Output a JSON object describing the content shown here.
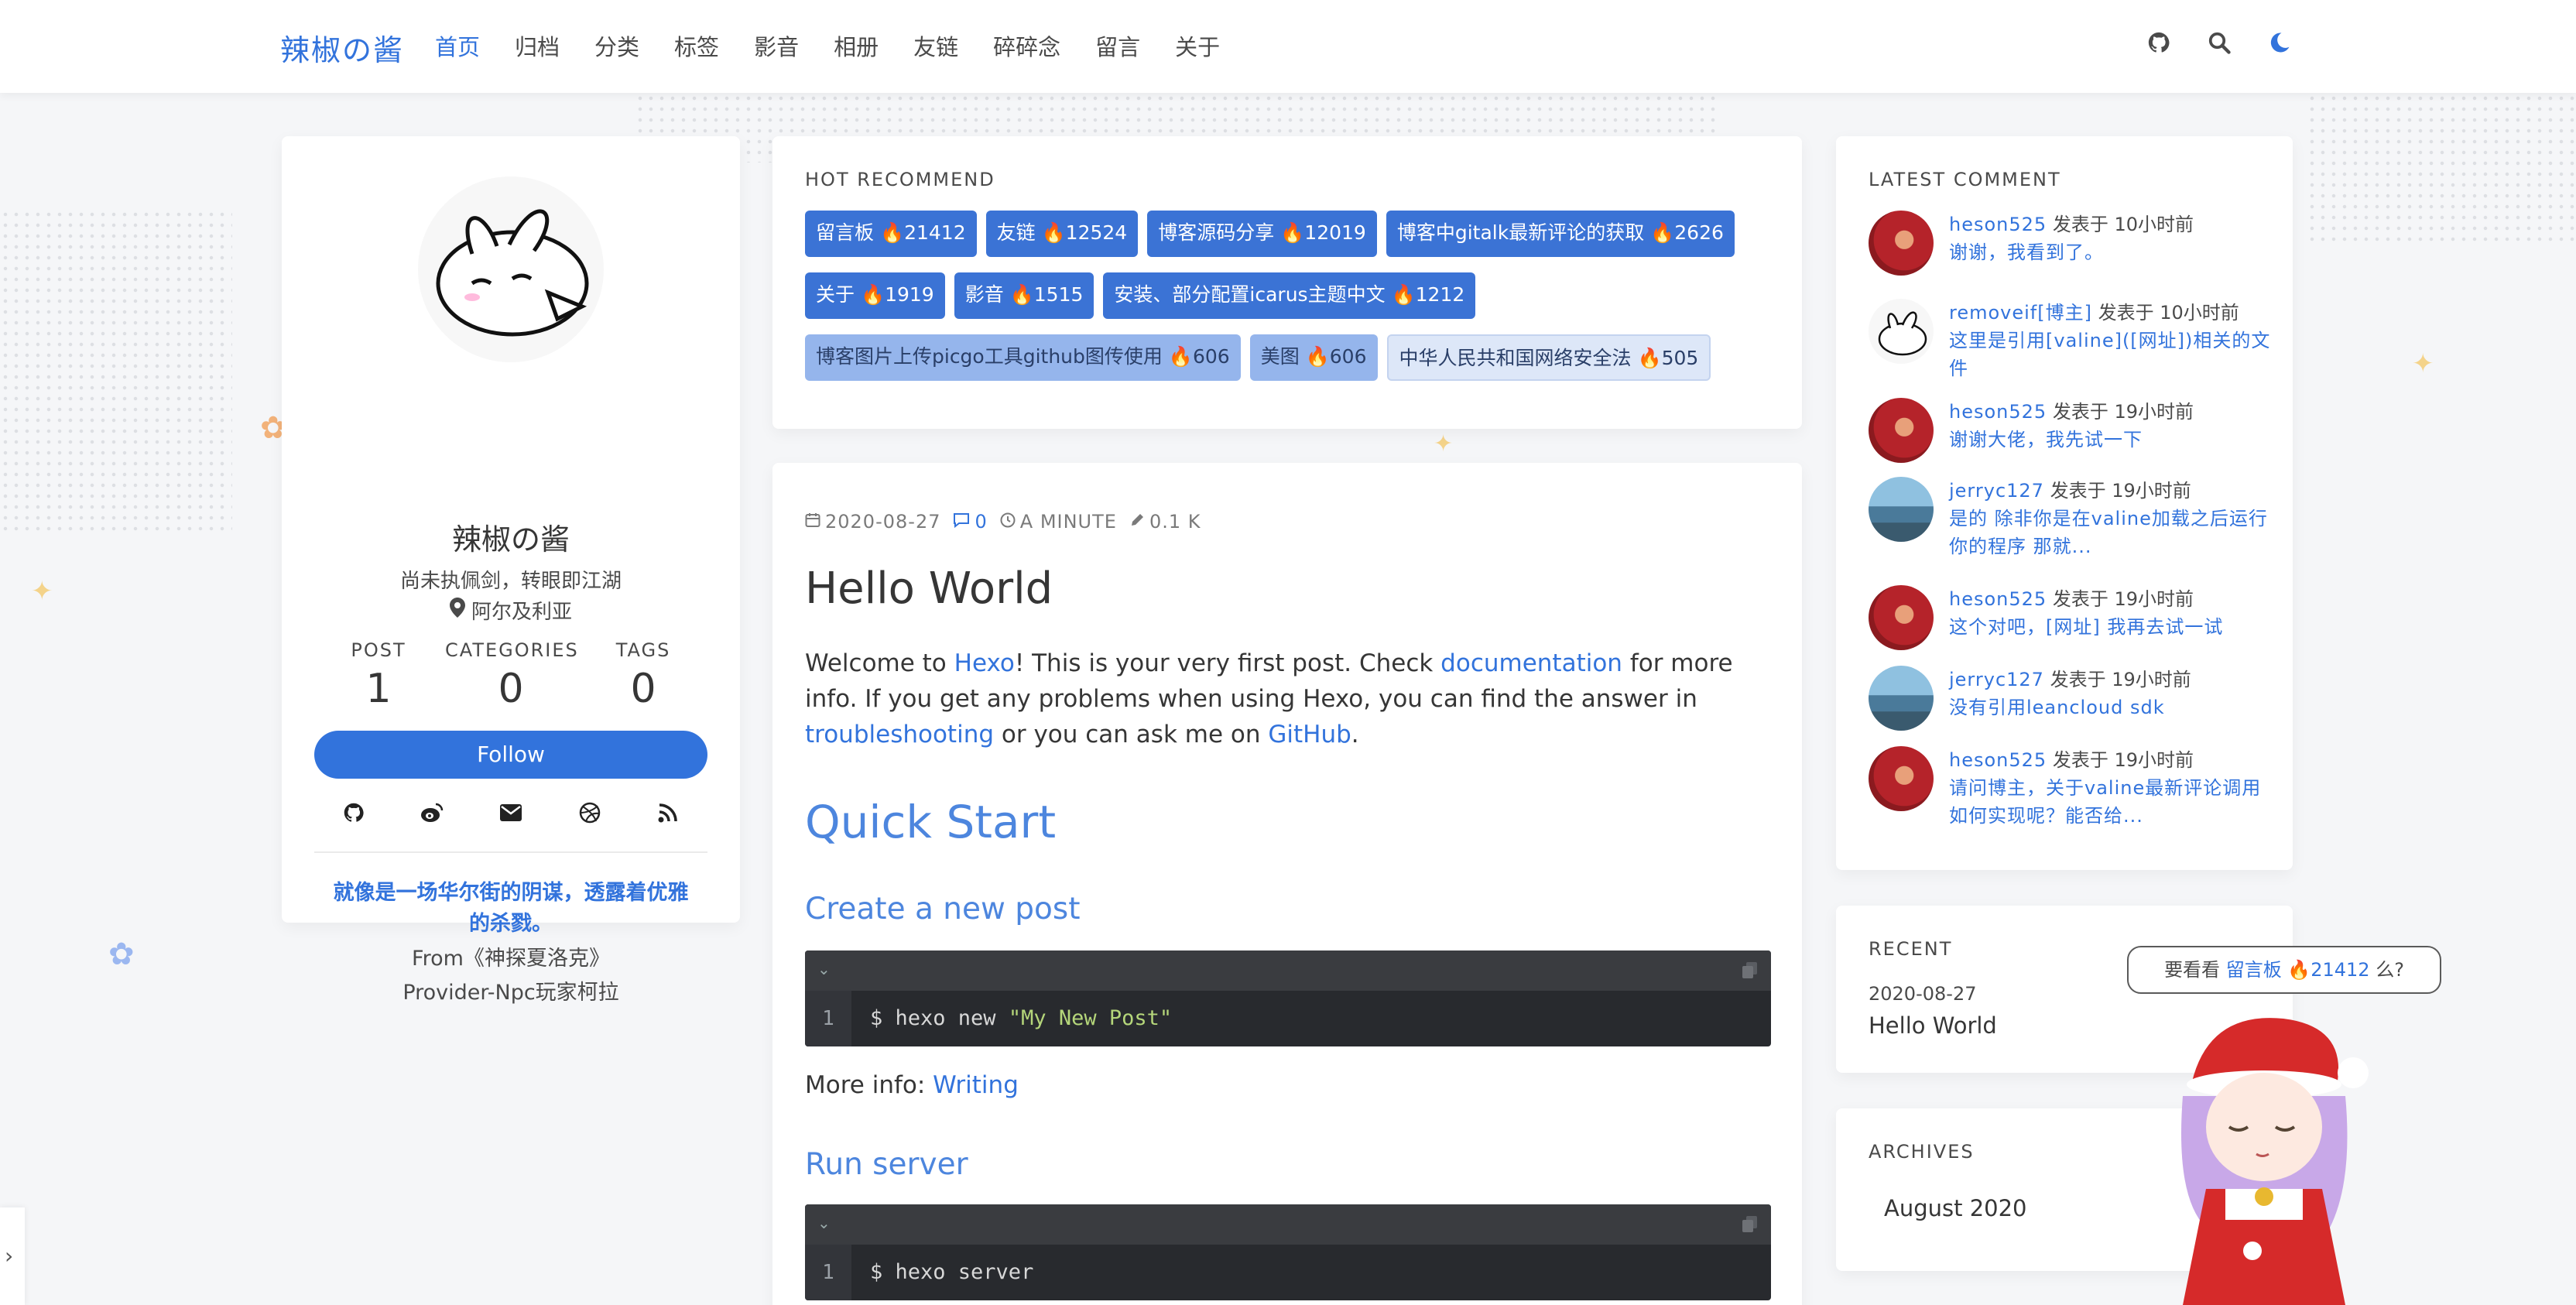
{
  "navbar": {
    "brand": "辣椒の酱",
    "items": [
      {
        "label": "首页",
        "active": true
      },
      {
        "label": "归档"
      },
      {
        "label": "分类"
      },
      {
        "label": "标签"
      },
      {
        "label": "影音"
      },
      {
        "label": "相册"
      },
      {
        "label": "友链"
      },
      {
        "label": "碎碎念"
      },
      {
        "label": "留言"
      },
      {
        "label": "关于"
      }
    ],
    "icons": [
      "github-icon",
      "search-icon",
      "moon-icon"
    ]
  },
  "profile": {
    "name": "辣椒の酱",
    "motto": "尚未执佩剑，转眼即江湖",
    "location": "阿尔及利亚",
    "stats": [
      {
        "label": "POST",
        "value": "1"
      },
      {
        "label": "CATEGORIES",
        "value": "0"
      },
      {
        "label": "TAGS",
        "value": "0"
      }
    ],
    "follow_label": "Follow",
    "socials": [
      "github-icon",
      "weibo-icon",
      "email-icon",
      "dribbble-icon",
      "rss-icon"
    ],
    "quote": "就像是一场华尔街的阴谋，透露着优雅的杀戮。",
    "quote_from": "From《神探夏洛克》",
    "quote_provider": "Provider-Npc玩家柯拉"
  },
  "hot": {
    "title": "HOT RECOMMEND",
    "tags": [
      {
        "label": "留言板 🔥21412",
        "level": 1
      },
      {
        "label": "友链 🔥12524",
        "level": 1
      },
      {
        "label": "博客源码分享 🔥12019",
        "level": 1
      },
      {
        "label": "博客中gitalk最新评论的获取 🔥2626",
        "level": 1
      },
      {
        "label": "关于 🔥1919",
        "level": 1
      },
      {
        "label": "影音 🔥1515",
        "level": 1
      },
      {
        "label": "安装、部分配置icarus主题中文 🔥1212",
        "level": 1
      },
      {
        "label": "博客图片上传picgo工具github图传使用 🔥606",
        "level": 2
      },
      {
        "label": "美图 🔥606",
        "level": 2
      },
      {
        "label": "中华人民共和国网络安全法 🔥505",
        "level": 3
      }
    ]
  },
  "post": {
    "date": "2020-08-27",
    "comments": "0",
    "read_time": "A MINUTE",
    "words": "0.1 K",
    "title": "Hello World",
    "intro": {
      "p1": "Welcome to ",
      "l1": "Hexo",
      "p2": "! This is your very first post. Check ",
      "l2": "documentation",
      "p3": " for more info. If you get any problems when using Hexo, you can find the answer in ",
      "l3": "troubleshooting",
      "p4": " or you can ask me on ",
      "l4": "GitHub",
      "p5": "."
    },
    "h1": "Quick Start",
    "h2_create": "Create a new post",
    "code1_line_no": "1",
    "code1_cmd": "$ hexo new ",
    "code1_str": "\"My New Post\"",
    "more_info_label": "More info: ",
    "more_info_link": "Writing",
    "h2_server": "Run server",
    "code2_line_no": "1",
    "code2_cmd": "$ hexo server"
  },
  "latest": {
    "title": "LATEST COMMENT",
    "comments": [
      {
        "user": "heson525",
        "time": " 发表于 10小时前",
        "msg": "谢谢，我看到了。",
        "avatar": "red"
      },
      {
        "user": "removeif[博主]",
        "time": " 发表于 10小时前",
        "msg": "这里是引用[valine]([网址])相关的文件",
        "avatar": "rabbit"
      },
      {
        "user": "heson525",
        "time": " 发表于 19小时前",
        "msg": "谢谢大佬，我先试一下",
        "avatar": "red"
      },
      {
        "user": "jerryc127",
        "time": " 发表于 19小时前",
        "msg": "是的 除非你是在valine加载之后运行你的程序 那就...",
        "avatar": "blue"
      },
      {
        "user": "heson525",
        "time": " 发表于 19小时前",
        "msg": "这个对吧，[网址] 我再去试一试",
        "avatar": "red"
      },
      {
        "user": "jerryc127",
        "time": " 发表于 19小时前",
        "msg": "没有引用leancloud sdk",
        "avatar": "blue"
      },
      {
        "user": "heson525",
        "time": " 发表于 19小时前",
        "msg": "请问博主，关于valine最新评论调用如何实现呢？能否给...",
        "avatar": "red"
      }
    ]
  },
  "recent": {
    "title": "RECENT",
    "date": "2020-08-27",
    "post_title": "Hello World"
  },
  "archives": {
    "title": "ARCHIVES",
    "item": "August 2020"
  },
  "bubble": {
    "prefix": "要看看 ",
    "link": "留言板 🔥21412",
    "suffix": " 么?"
  },
  "colors": {
    "accent": "#3273dc",
    "tag_dark": "#3b73d5",
    "heading": "#4d86de"
  }
}
